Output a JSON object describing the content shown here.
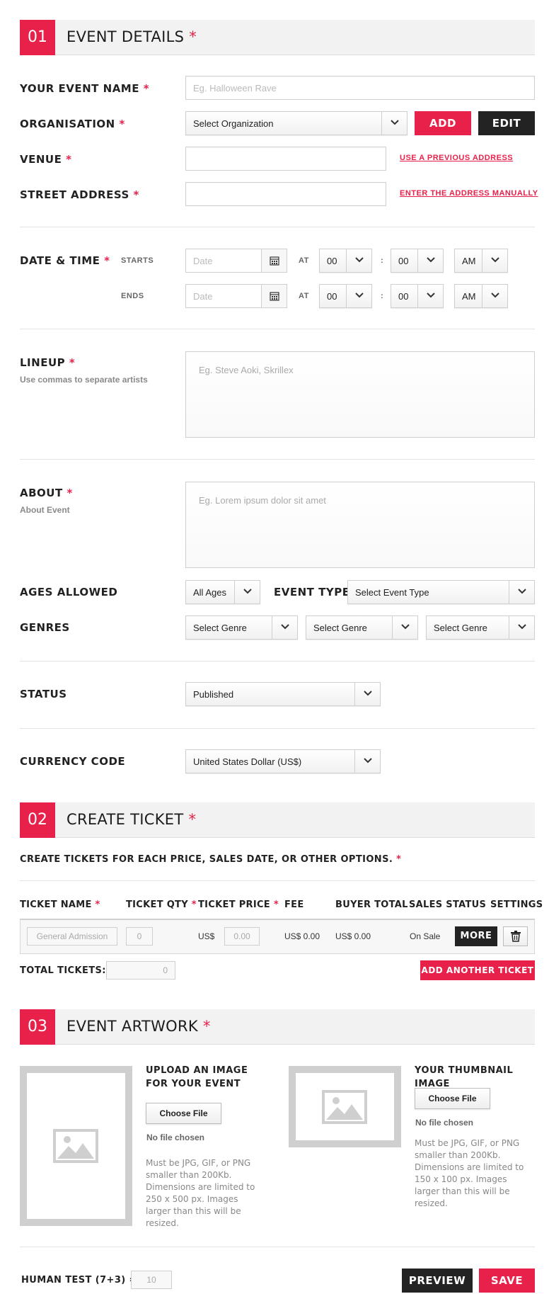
{
  "section1": {
    "number": "01",
    "title": "EVENT DETAILS",
    "required": "*"
  },
  "event_name": {
    "label": "YOUR EVENT NAME",
    "placeholder": "Eg. Halloween Rave"
  },
  "organisation": {
    "label": "ORGANISATION",
    "value": "Select Organization",
    "add": "ADD",
    "edit": "EDIT"
  },
  "venue": {
    "label": "VENUE",
    "link": "USE A PREVIOUS ADDRESS"
  },
  "street": {
    "label": "STREET ADDRESS",
    "link": "ENTER THE ADDRESS MANUALLY"
  },
  "datetime": {
    "label": "DATE & TIME",
    "starts": "STARTS",
    "ends": "ENDS",
    "at": "AT",
    "colon": ":",
    "date_placeholder": "Date",
    "hour": "00",
    "minute": "00",
    "ampm": "AM"
  },
  "lineup": {
    "label": "LINEUP",
    "hint": "Use commas to separate artists",
    "placeholder": "Eg. Steve Aoki, Skrillex"
  },
  "about": {
    "label": "ABOUT",
    "hint": "About Event",
    "placeholder": "Eg. Lorem ipsum dolor sit amet"
  },
  "ages": {
    "label": "AGES ALLOWED",
    "value": "All Ages"
  },
  "event_type": {
    "label": "EVENT TYPE",
    "value": "Select Event Type"
  },
  "genres": {
    "label": "GENRES",
    "values": [
      "Select Genre",
      "Select Genre",
      "Select Genre"
    ]
  },
  "status": {
    "label": "STATUS",
    "value": "Published"
  },
  "currency": {
    "label": "CURRENCY CODE",
    "value": "United States Dollar (US$)"
  },
  "section2": {
    "number": "02",
    "title": "CREATE TICKET",
    "required": "*"
  },
  "ticket_intro": "CREATE TICKETS FOR EACH PRICE, SALES DATE, OR OTHER OPTIONS.",
  "ticket_columns": [
    "TICKET NAME",
    "TICKET QTY",
    "TICKET PRICE",
    "FEE",
    "BUYER TOTAL",
    "SALES STATUS",
    "SETTINGS"
  ],
  "ticket_row": {
    "name_placeholder": "General Admission",
    "qty_placeholder": "0",
    "price_prefix": "US$",
    "price_placeholder": "0.00",
    "fee": "US$ 0.00",
    "buyer_total": "US$ 0.00",
    "sales_status": "On Sale",
    "more": "MORE"
  },
  "total_tickets": {
    "label": "TOTAL TICKETS:",
    "value": "0"
  },
  "add_ticket": "ADD ANOTHER TICKET",
  "section3": {
    "number": "03",
    "title": "EVENT ARTWORK",
    "required": "*"
  },
  "artwork_main": {
    "title_line1": "UPLOAD AN IMAGE",
    "title_line2": "FOR YOUR EVENT",
    "choose": "Choose File",
    "no_file": "No file chosen",
    "note": [
      "Must be JPG, GIF, or PNG",
      "smaller than 200Kb.",
      "Dimensions are limited to",
      "250 x 500 px. Images",
      "larger than this will be",
      "resized."
    ]
  },
  "artwork_thumb": {
    "title": "YOUR THUMBNAIL IMAGE",
    "choose": "Choose File",
    "no_file": "No file chosen",
    "note": [
      "Must be JPG, GIF, or PNG",
      "smaller than 200Kb.",
      "Dimensions are limited to",
      "150 x 100 px. Images",
      "larger than this will be",
      "resized."
    ]
  },
  "human_test": {
    "label": "HUMAN TEST (7+3) =",
    "value": "10"
  },
  "preview": "PREVIEW",
  "save": "SAVE",
  "colors": {
    "accent": "#e8214b",
    "dark": "#232323"
  },
  "icons": [
    "chevron-down-icon",
    "calendar-icon",
    "trash-icon",
    "image-placeholder-icon"
  ]
}
